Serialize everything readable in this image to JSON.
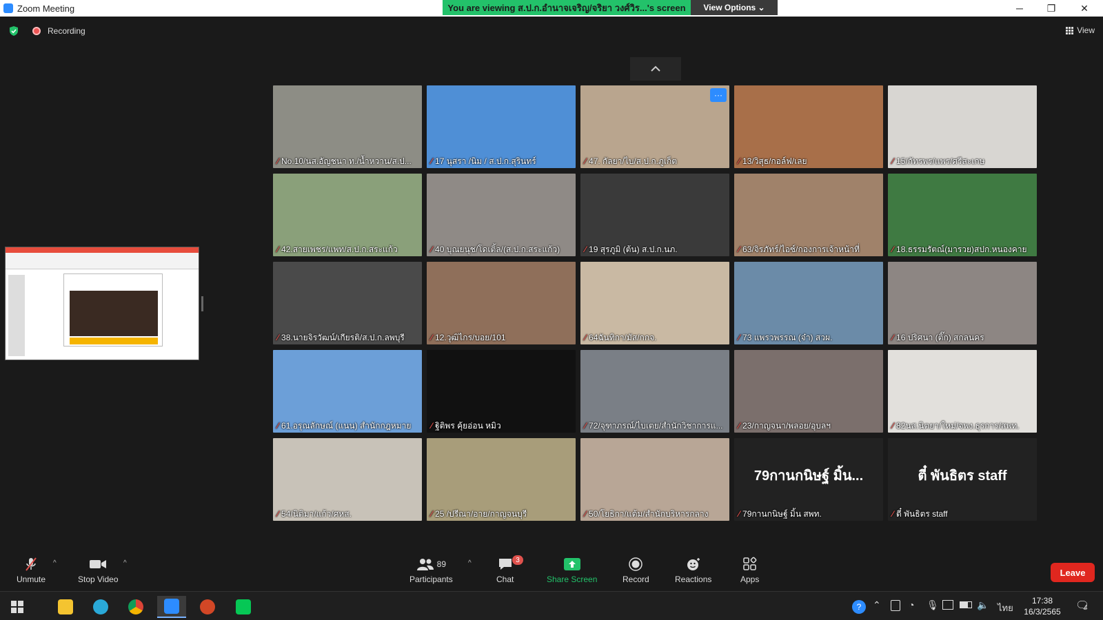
{
  "window": {
    "title": "Zoom Meeting",
    "minimize": "─",
    "restore": "❐",
    "close": "✕"
  },
  "banner": {
    "viewing_text": "You are viewing ส.ป.ก.อำนาจเจริญ/จริยา วงศ์วิร...'s screen",
    "view_options": "View Options ⌄"
  },
  "status": {
    "recording": "Recording",
    "view_label": "View"
  },
  "page_up_icon": "chevron-up-icon",
  "participants": [
    {
      "name": "No.10/นส.อัญชนา ท./น้ำหวาน/ส.ป...",
      "bg": "#8d8d85"
    },
    {
      "name": "17 นุสรา /นิม / ส.ป.ก.สุรินทร์",
      "bg": "#4f8fd6"
    },
    {
      "name": "47. กัลยา/ไบ/ส.ป.ก.ภูเก็ต",
      "bg": "#b9a58e",
      "more": "···"
    },
    {
      "name": "13/วิสุธ/กอล์ฟ/เลย",
      "bg": "#a86f49"
    },
    {
      "name": "15/กัทรพร/แพร/ศรีสะเกษ",
      "bg": "#d8d6d2"
    },
    {
      "name": "42.สายเพชร/แพท/ส.ป.ก.สระแก้ว",
      "bg": "#8aa07a"
    },
    {
      "name": "40 บุณยนุช/โดเติ้ล/(ส.ป.ก.สระแก้ว)",
      "bg": "#8f8a86"
    },
    {
      "name": "19 สุรภูมิ (ต้น) ส.ป.ก.นภ.",
      "bg": "#3a3a3a"
    },
    {
      "name": "63/จิรภัทร์/ไอซ์/กองการเจ้าหน้าที่",
      "bg": "#a0826a"
    },
    {
      "name": "18.ธรรมรัตณ์(มารวย)สปก.หนองคาย",
      "bg": "#3f7a42"
    },
    {
      "name": "38.นายจิรวัฒน์/เกียรติ/ส.ป.ก.ลพบุรี",
      "bg": "#4a4a4a"
    },
    {
      "name": "12.วุฒิไกร/บอย/101",
      "bg": "#8f6f5a"
    },
    {
      "name": "64ฉันทิกา/มัส/กกจ.",
      "bg": "#c9b9a3"
    },
    {
      "name": "73 แพรวพรรณ (จ๋า) สวผ.",
      "bg": "#6b8ba8"
    },
    {
      "name": "16 ปริศนา (ติ๊ก) สกลนคร",
      "bg": "#8d8683"
    },
    {
      "name": "61.อรุณลักษณ์ (แนน) สำนักกฎหมาย",
      "bg": "#6c9fd8"
    },
    {
      "name": "ฐิติพร คุ้ยอ่อน หมิว",
      "bg": "#111111"
    },
    {
      "name": "72/จุฑาภรณ์/ไบเตย/สำนักวิชาการแ...",
      "bg": "#7a7f86"
    },
    {
      "name": "23/กาญจนา/พลอย/อุบลฯ",
      "bg": "#7b6f6c"
    },
    {
      "name": "82นส.นิตยา/ใหม่/จพง.ธุรการ/สพท.",
      "bg": "#e2e0dc"
    },
    {
      "name": "54/นิติมา/แก้ว/ศหส.",
      "bg": "#c8c2b8"
    },
    {
      "name": "25 /ปรีณา/อาย/กาญจนบุรี",
      "bg": "#a89d7a"
    },
    {
      "name": "50/โยธิกา/แต้ม/สำนักบริหารกลาง",
      "bg": "#b8a696"
    },
    {
      "name": "79กานกนิษฐ์ มิ้น สพท.",
      "big": "79กานกนิษฐ์ มิ้น...",
      "bg": "#222222"
    },
    {
      "name": "ตี๋ พันธิตร staff",
      "big": "ตี๋ พันธิตร staff",
      "bg": "#222222"
    }
  ],
  "toolbar": {
    "unmute": "Unmute",
    "stop_video": "Stop Video",
    "participants": "Participants",
    "participant_count": "89",
    "chat": "Chat",
    "chat_badge": "3",
    "share_screen": "Share Screen",
    "record": "Record",
    "reactions": "Reactions",
    "apps": "Apps",
    "leave": "Leave",
    "caret": "^"
  },
  "taskbar": {
    "clock_time": "17:38",
    "clock_date": "16/3/2565",
    "lang": "ไทย",
    "notif_count": "4"
  },
  "colors": {
    "accent_green": "#23c26a",
    "leave_red": "#e0271f",
    "zoom_blue": "#2d8cff",
    "mic_muted": "#e0524d"
  }
}
